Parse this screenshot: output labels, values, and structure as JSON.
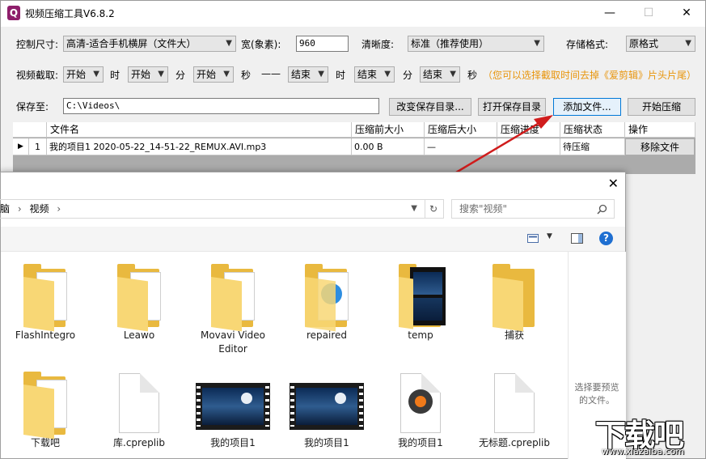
{
  "app": {
    "icon_glyph": "Q",
    "title": "视频压缩工具V6.8.2",
    "window_buttons": [
      "—",
      "☐",
      "✕"
    ]
  },
  "controls": {
    "size_label": "控制尺寸:",
    "size_value": "高清-适合手机横屏（文件大）",
    "width_label": "宽(象素):",
    "width_value": "960",
    "clarity_label": "清晰度:",
    "clarity_value": "标准（推荐使用）",
    "format_label": "存储格式:",
    "format_value": "原格式",
    "clip_label": "视频截取:",
    "start_h": "开始",
    "unit_h1": "时",
    "start_m": "开始",
    "unit_m1": "分",
    "start_s": "开始",
    "unit_s1": "秒",
    "dash": "——",
    "end_h": "结束",
    "unit_h2": "时",
    "end_m": "结束",
    "unit_m2": "分",
    "end_s": "结束",
    "unit_s2": "秒",
    "hint": "（您可以选择截取时间去掉《爱剪辑》片头片尾）",
    "save_label": "保存至:",
    "save_path": "C:\\Videos\\",
    "change_dir_button": "改变保存目录...",
    "open_dir_button": "打开保存目录",
    "add_file_button": "添加文件...",
    "start_button": "开始压缩"
  },
  "grid": {
    "headers": [
      "",
      "文件名",
      "压缩前大小",
      "压缩后大小",
      "压缩进度",
      "压缩状态",
      "操作"
    ],
    "row": {
      "indicator": "▶",
      "index": "1",
      "file_name": "我的项目1 2020-05-22_14-51-22_REMUX.AVI.mp3",
      "size_before": "0.00 B",
      "size_after": "—",
      "progress": "",
      "status": "待压缩",
      "action": "移除文件"
    }
  },
  "dialog": {
    "close_glyph": "✕",
    "breadcrumb": [
      "脑",
      "视频"
    ],
    "search_placeholder": "搜索\"视频\"",
    "preview_text": "选择要预览的文件。",
    "items_row1": [
      "FlashIntegro",
      "Leawo",
      "Movavi Video Editor",
      "repaired",
      "temp",
      "捕获"
    ],
    "items_row2": [
      "下载吧",
      "库.cpreplib",
      "我的项目1",
      "我的项目1",
      "我的项目1",
      "无标题.cpreplib"
    ]
  },
  "colors": {
    "hint": "#e8950c",
    "arrow": "#d01c1c",
    "folder": "#e9b93f",
    "app_icon": "#8e1e6b"
  },
  "watermark": {
    "text": "下载吧",
    "url": "www.xiazaiba.com"
  }
}
